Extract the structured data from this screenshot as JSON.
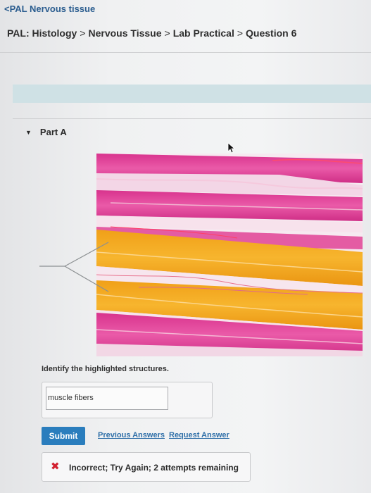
{
  "header": {
    "back_link": "<PAL Nervous tissue",
    "breadcrumb": [
      "PAL: Histology",
      "Nervous Tissue",
      "Lab Practical",
      "Question 6"
    ],
    "breadcrumb_separator": ">"
  },
  "part": {
    "label": "Part A",
    "expanded": true
  },
  "image": {
    "icon": "micrograph-muscle-tissue",
    "colors": {
      "pink": "#e2459a",
      "orange": "#f4a51d",
      "white": "#f8eef3"
    }
  },
  "question": {
    "prompt": "Identify the highlighted structures.",
    "answer_value": "muscle fibers"
  },
  "actions": {
    "submit_label": "Submit",
    "previous_answers_label": "Previous Answers",
    "request_answer_label": "Request Answer"
  },
  "feedback": {
    "icon": "x-mark-icon",
    "message": "Incorrect; Try Again; 2 attempts remaining",
    "status_color": "#d2202f"
  },
  "theme": {
    "accent": "#2a7dbd",
    "link": "#2f6fa8",
    "info_bar": "#cfe1e5"
  }
}
